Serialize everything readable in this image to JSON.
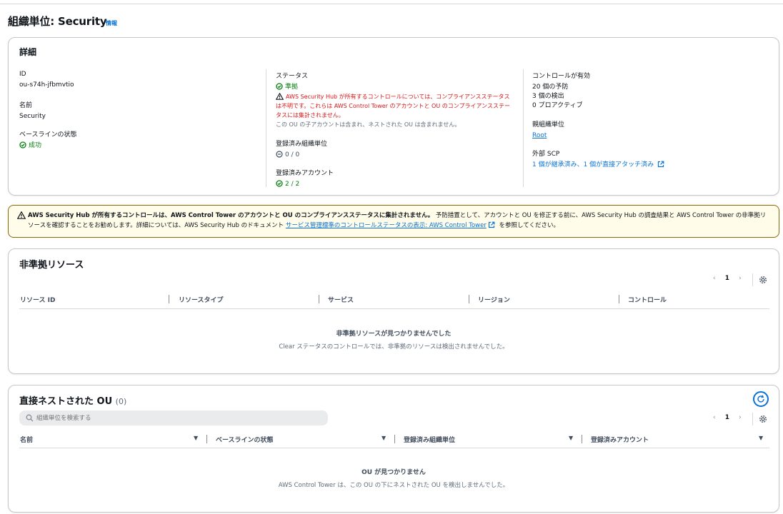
{
  "page": {
    "title": "組織単位: Security",
    "info_label": "情報"
  },
  "details": {
    "title": "詳細",
    "id_label": "ID",
    "id_value": "ou-s74h-jfbmvtio",
    "name_label": "名前",
    "name_value": "Security",
    "baseline_label": "ベースラインの状態",
    "baseline_value": "成功",
    "status_label": "ステータス",
    "status_value": "準拠",
    "status_warning": "AWS Security Hub が所有するコントロールについては、コンプライアンスステータスは不明です。これらは AWS Control Tower のアカウントと OU のコンプライアンスステータスには集計されません。",
    "status_note": "この OU の子アカウントは含まれ、ネストされた OU は含まれません。",
    "registered_ou_label": "登録済み組織単位",
    "registered_ou_value": "0 / 0",
    "registered_acct_label": "登録済みアカウント",
    "registered_acct_value": "2 / 2",
    "controls_label": "コントロールが有効",
    "controls_preventive": "20 個の予防",
    "controls_detective": "3 個の検出",
    "controls_proactive": "0 プロアクティブ",
    "parent_ou_label": "親組織単位",
    "parent_ou_value": "Root",
    "scp_label": "外部 SCP",
    "scp_value": "1 個が継承済み、1 個が直接アタッチ済み"
  },
  "alert": {
    "bold": "AWS Security Hub が所有するコントロールは、AWS Control Tower のアカウントと OU のコンプライアンスステータスに集計されません。",
    "text1": " 予防措置として、アカウントと OU を修正する前に、AWS Security Hub の調査結果と AWS Control Tower の非準拠リソースを確認することをお勧めします。詳細については、AWS Security Hub のドキュメント ",
    "link": "サービス管理標準のコントロールステータスの表示: AWS Control Tower",
    "text2": " を参照してください。"
  },
  "noncompliant": {
    "title": "非準拠リソース",
    "page": "1",
    "columns": [
      "リソース ID",
      "リソースタイプ",
      "サービス",
      "リージョン",
      "コントロール"
    ],
    "empty_title": "非準拠リソースが見つかりませんでした",
    "empty_sub": "Clear ステータスのコントロールでは、非準拠のリソースは検出されませんでした。"
  },
  "nested": {
    "title": "直接ネストされた OU",
    "count": "(0)",
    "search_placeholder": "組織単位を検索する",
    "page": "1",
    "columns": [
      "名前",
      "ベースラインの状態",
      "登録済み組織単位",
      "登録済みアカウント"
    ],
    "empty_title": "OU が見つかりません",
    "empty_sub": "AWS Control Tower は、この OU の下にネストされた OU を検出しませんでした。"
  },
  "colors": {
    "success": "#037f0c",
    "error": "#d91515",
    "link": "#0972d3",
    "warning_bg": "#fffce9",
    "warning_border": "#8d6605"
  },
  "icons": [
    "status-positive-icon",
    "warning-icon",
    "status-stopped-icon",
    "external-link-icon",
    "settings-icon",
    "search-icon",
    "refresh-icon",
    "caret-down-icon"
  ]
}
